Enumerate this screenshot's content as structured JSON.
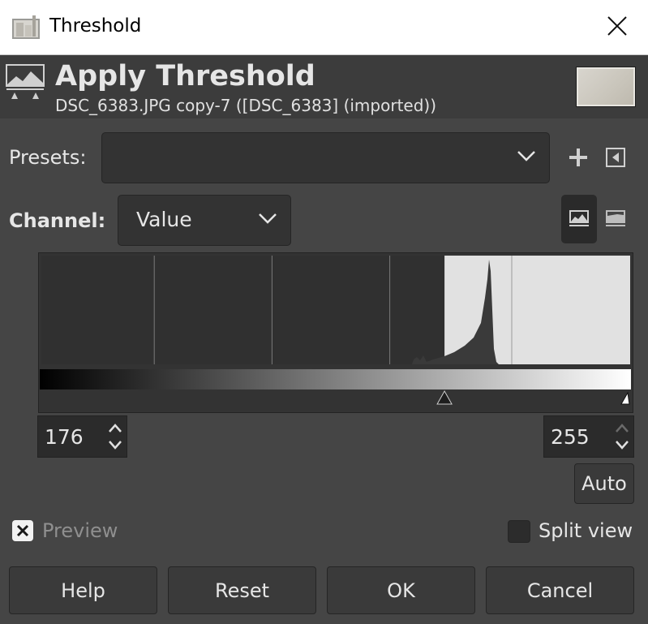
{
  "window": {
    "title": "Threshold",
    "close_icon": "close-icon"
  },
  "header": {
    "title": "Apply Threshold",
    "subtitle": "DSC_6383.JPG copy-7 ([DSC_6383] (imported))"
  },
  "presets": {
    "label": "Presets:",
    "value": ""
  },
  "channel": {
    "label": "Channel:",
    "value": "Value"
  },
  "histogram": {
    "low": 176,
    "high": 255,
    "range_max": 255
  },
  "low_spin": {
    "value": "176"
  },
  "high_spin": {
    "value": "255"
  },
  "auto_label": "Auto",
  "preview": {
    "label": "Preview",
    "checked": true
  },
  "split_view": {
    "label": "Split view",
    "checked": false
  },
  "buttons": {
    "help": "Help",
    "reset": "Reset",
    "ok": "OK",
    "cancel": "Cancel"
  },
  "colors": {
    "bg": "#454545",
    "panel": "#333333",
    "hist_highlight": "#e1e1e1",
    "text": "#e6e6e6"
  }
}
